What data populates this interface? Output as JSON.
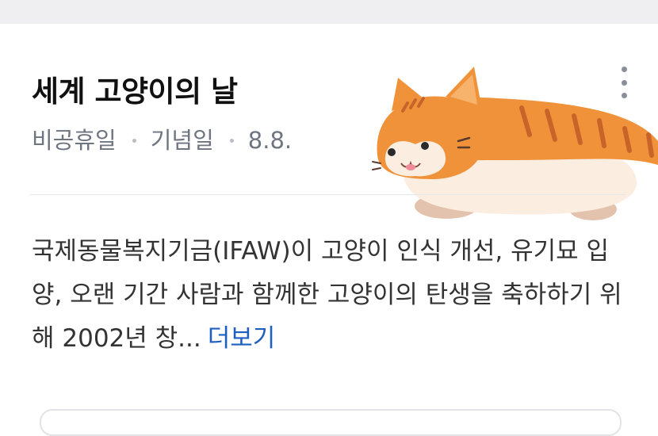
{
  "card": {
    "title": "세계 고양이의 날",
    "meta": {
      "category": "비공휴일",
      "type": "기념일",
      "date": "8.8."
    },
    "description": "국제동물복지기금(IFAW)이 고양이 인식 개선, 유기묘 입양, 오랜 기간 사람과 함께한 고양이의 탄생을 축하하기 위해 2002년 창...",
    "more_label": "더보기",
    "menu_icon": "more-vertical-icon",
    "illustration": "orange-tabby-cat-illustration"
  },
  "colors": {
    "title": "#111111",
    "meta": "#6e7480",
    "link": "#1f5fbf",
    "cat_orange": "#f0923a",
    "cat_cream": "#fbeee0"
  }
}
